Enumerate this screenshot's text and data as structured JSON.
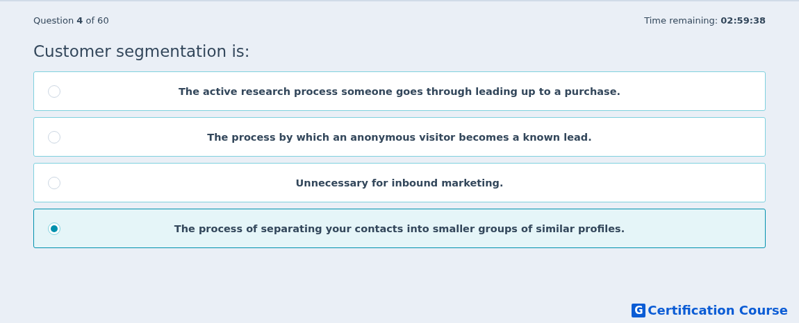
{
  "progress": "Question **4** of 60",
  "timer": "Time remaining: **02:59:38**",
  "question": "Customer segmentation is:",
  "options": [
    {
      "label": "The active research process someone goes through leading up to a purchase.",
      "selected": false
    },
    {
      "label": "The process by which an anonymous visitor becomes a known lead.",
      "selected": false
    },
    {
      "label": "Unnecessary for inbound marketing.",
      "selected": false
    },
    {
      "label": "The process of separating your contacts into smaller groups of similar profiles.",
      "selected": true
    }
  ],
  "brand": {
    "mark": "G",
    "name": "Certification Course"
  }
}
